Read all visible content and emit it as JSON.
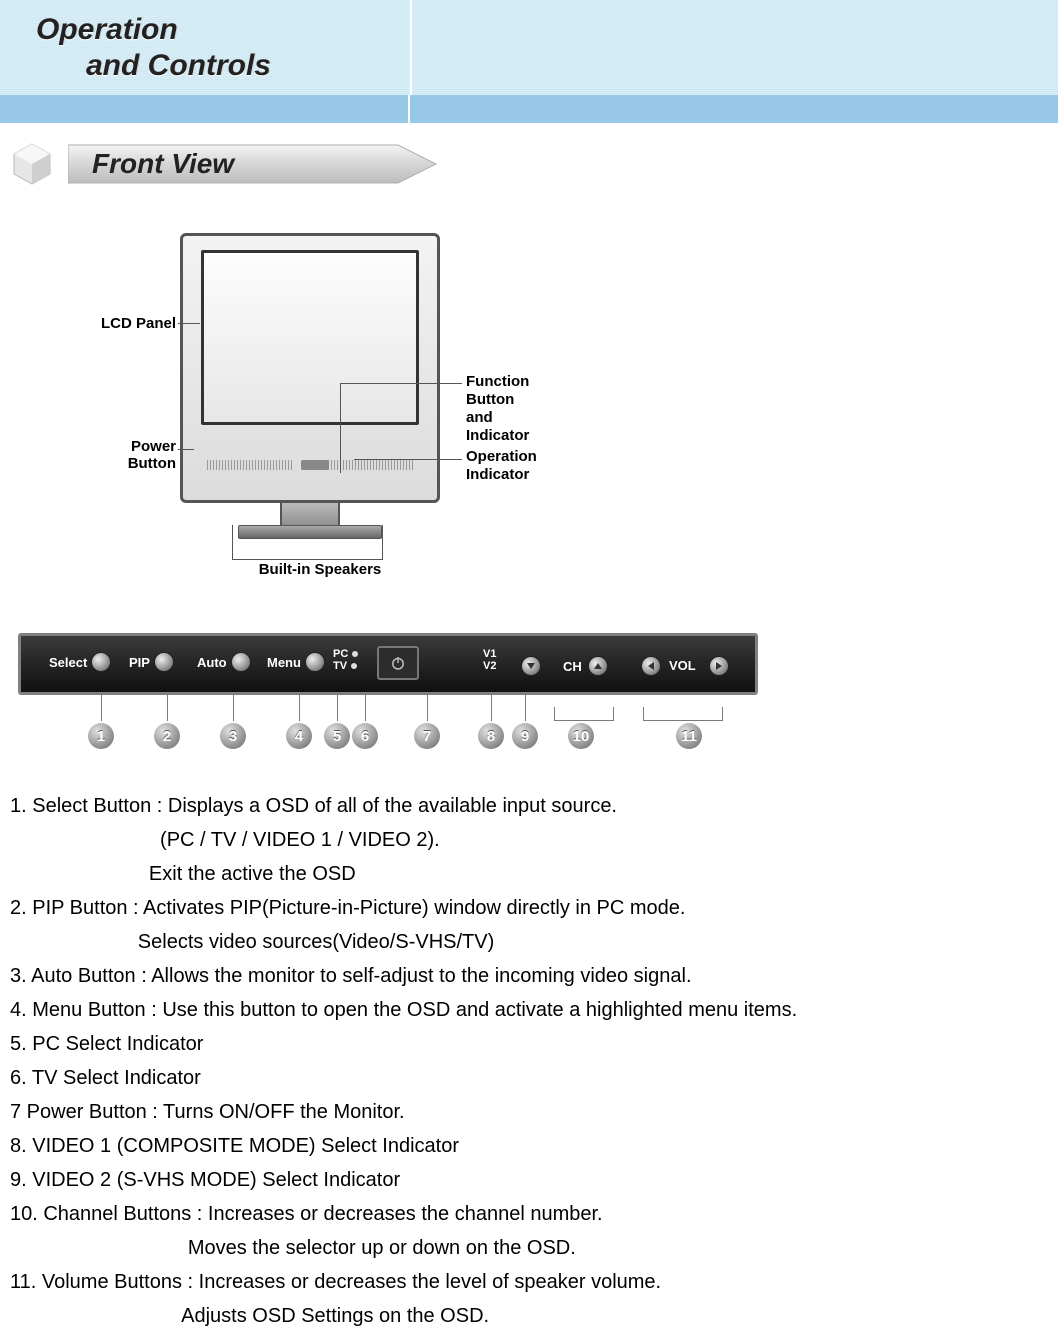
{
  "header": {
    "title_line1": "Operation",
    "title_line2": "and Controls"
  },
  "section": {
    "heading": "Front View"
  },
  "diagram": {
    "labels": {
      "lcd_panel": "LCD Panel",
      "power_button": "Power\nButton",
      "function_button": "Function\nButton\nand\nIndicator",
      "operation_indicator": "Operation\nIndicator",
      "speakers": "Built-in Speakers"
    }
  },
  "panel": {
    "buttons": {
      "select": "Select",
      "pip": "PIP",
      "auto": "Auto",
      "menu": "Menu",
      "pc": "PC",
      "tv": "TV",
      "v1": "V1",
      "v2": "V2",
      "ch": "CH",
      "vol": "VOL"
    },
    "badges": [
      "1",
      "2",
      "3",
      "4",
      "5",
      "6",
      "7",
      "8",
      "9",
      "10",
      "11"
    ]
  },
  "descriptions": [
    "1. Select Button : Displays a OSD of all of the available input source.",
    "                           (PC / TV / VIDEO 1 / VIDEO 2).",
    "                         Exit the active the OSD",
    "2. PIP Button : Activates PIP(Picture-in-Picture) window directly in PC mode.",
    "                       Selects video sources(Video/S-VHS/TV)",
    "3. Auto Button : Allows the monitor to self-adjust to the incoming video signal.",
    "4. Menu Button : Use this button to open the OSD and activate a highlighted menu items.",
    "5. PC Select Indicator",
    "6. TV Select Indicator",
    "7 Power Button : Turns ON/OFF the Monitor.",
    "8. VIDEO 1 (COMPOSITE MODE) Select Indicator",
    "9. VIDEO 2 (S-VHS MODE) Select Indicator",
    "10. Channel Buttons : Increases or decreases the channel number.",
    "                                Moves the selector up or down on the OSD.",
    "11. Volume Buttons : Increases or decreases the level of speaker volume.",
    "                               Adjusts OSD Settings on the OSD."
  ]
}
